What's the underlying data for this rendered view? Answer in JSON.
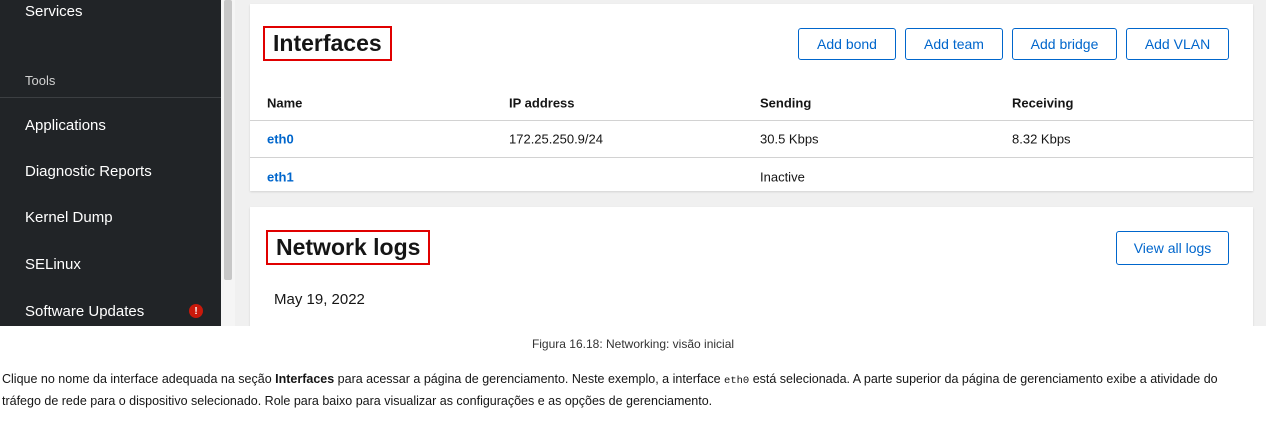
{
  "sidebar": {
    "items": [
      {
        "label": "Services"
      },
      {
        "label": "Applications"
      },
      {
        "label": "Diagnostic Reports"
      },
      {
        "label": "Kernel Dump"
      },
      {
        "label": "SELinux"
      },
      {
        "label": "Software Updates"
      }
    ],
    "section_label": "Tools",
    "alert_glyph": "!"
  },
  "interfaces": {
    "title": "Interfaces",
    "buttons": [
      "Add bond",
      "Add team",
      "Add bridge",
      "Add VLAN"
    ],
    "columns": [
      "Name",
      "IP address",
      "Sending",
      "Receiving"
    ],
    "rows": [
      {
        "name": "eth0",
        "ip": "172.25.250.9/24",
        "sending": "30.5 Kbps",
        "receiving": "8.32 Kbps"
      },
      {
        "name": "eth1",
        "ip": "",
        "sending": "Inactive",
        "receiving": ""
      }
    ]
  },
  "network_logs": {
    "title": "Network logs",
    "view_all_label": "View all logs",
    "date": "May 19, 2022"
  },
  "caption": "Figura 16.18: Networking: visão inicial",
  "paragraph": {
    "t1": "Clique no nome da interface adequada na seção ",
    "bold": "Interfaces",
    "t2": " para acessar a página de gerenciamento. Neste exemplo, a interface ",
    "code": "eth0",
    "t3": " está selecionada. A parte superior da página de gerenciamento exibe a atividade do tráfego de rede para o dispositivo selecionado. Role para baixo para visualizar as configurações e as opções de gerenciamento."
  },
  "colors": {
    "sidebar_bg": "#212427",
    "link": "#0066cc",
    "highlight_border": "#e00000",
    "alert": "#c9190b"
  }
}
